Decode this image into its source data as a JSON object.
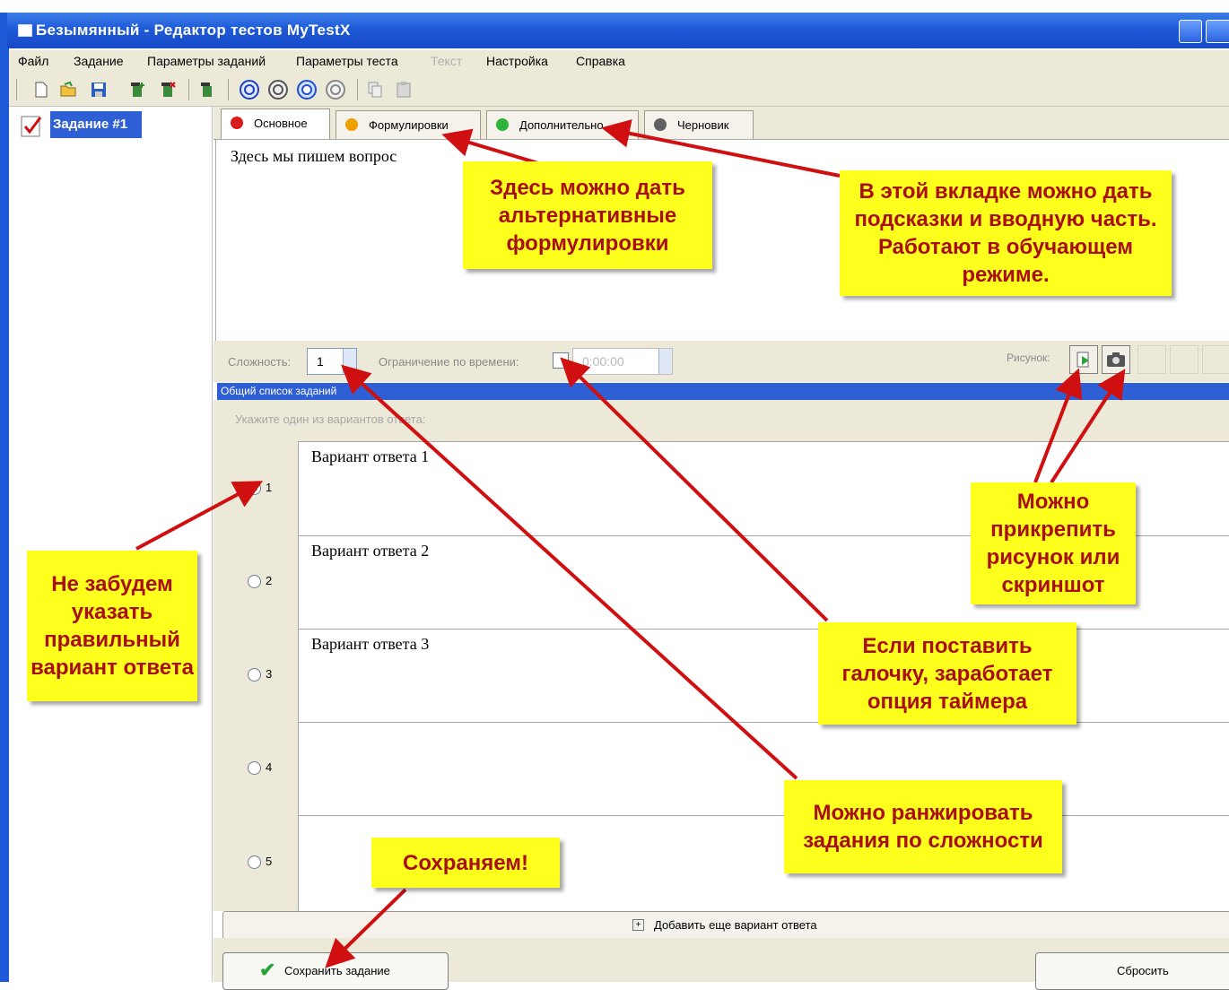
{
  "window": {
    "title": "Безымянный - Редактор тестов MyTestX"
  },
  "menu": {
    "items": [
      "Файл",
      "Задание",
      "Параметры заданий",
      "Параметры теста",
      "Текст",
      "Настройка",
      "Справка"
    ]
  },
  "toolbar": {
    "icons": [
      "new-file-icon",
      "open-folder-icon",
      "save-icon",
      "add-task-icon",
      "delete-task-icon",
      "task-icon",
      "circle-arrow-1-icon",
      "circle-arrow-2-icon",
      "circle-arrow-3-icon",
      "circle-arrow-4-icon",
      "copy-icon",
      "paste-icon"
    ]
  },
  "tree": {
    "task_label": "Задание #1"
  },
  "tabs": [
    {
      "label": "Основное",
      "color": "#d81c1c"
    },
    {
      "label": "Формулировки",
      "color": "#f0a000"
    },
    {
      "label": "Дополнительно",
      "color": "#2fb33a"
    },
    {
      "label": "Черновик",
      "color": "#606060"
    }
  ],
  "question": {
    "text": "Здесь мы пишем вопрос"
  },
  "params": {
    "difficulty_label": "Сложность:",
    "difficulty_value": "1",
    "time_limit_label": "Ограничение по времени:",
    "time_value": "0:00:00",
    "picture_label": "Рисунок:"
  },
  "list_header": "Общий список заданий",
  "answer_hint": "Укажите один из вариантов ответа:",
  "answers": [
    {
      "num": "1",
      "text": "Вариант ответа 1",
      "selected": true
    },
    {
      "num": "2",
      "text": "Вариант ответа 2",
      "selected": false
    },
    {
      "num": "3",
      "text": "Вариант ответа 3",
      "selected": false
    },
    {
      "num": "4",
      "text": "",
      "selected": false
    },
    {
      "num": "5",
      "text": "",
      "selected": false
    }
  ],
  "add_answer_label": "Добавить еще вариант ответа",
  "save_button": "Сохранить задание",
  "reset_button": "Сбросить",
  "callouts": {
    "formulations": "Здесь можно дать альтернативные формулировки",
    "additional": "В этой вкладке можно дать подсказки и вводную часть. Работают в обучающем режиме.",
    "picture": "Можно прикрепить рисунок или скриншот",
    "correct": "Не забудем указать правильный вариант ответа",
    "timer": "Если поставить галочку, заработает опция таймера",
    "rank": "Можно ранжировать задания по сложности",
    "save": "Сохраняем!"
  },
  "colors": {
    "callout_bg": "#ffff1e",
    "callout_text": "#a80f0f",
    "arrow": "#d01010",
    "selection": "#2f5fd4"
  }
}
